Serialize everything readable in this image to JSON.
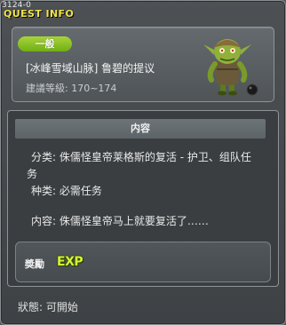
{
  "window": {
    "quest_id": "3124-0",
    "title": "QUEST INFO"
  },
  "header": {
    "category": "一般",
    "quest_name": "[冰峰雪域山脉] 鲁碧的提议",
    "level_label": "建議等級:",
    "level_range": "170~174",
    "npc_icon": "goblin-npc-icon"
  },
  "content": {
    "section_title": "内容",
    "type_label": "分类:",
    "type_line1": "侏儒怪皇帝莱格斯的复活 - 护卫、组队任",
    "type_line2": "务",
    "kind_label": "种类:",
    "kind_value": "必需任务",
    "desc_label": "内容:",
    "desc_value": "侏儒怪皇帝马上就要复活了……"
  },
  "reward": {
    "label": "奬勵",
    "exp_icon_text": "EXP",
    "exp_icon": "exp-icon"
  },
  "status": {
    "label": "狀態:",
    "value": "可開始"
  },
  "colors": {
    "title_yellow": "#f2e64a",
    "badge_green": "#86c01f",
    "exp_green": "#d8f13a"
  }
}
